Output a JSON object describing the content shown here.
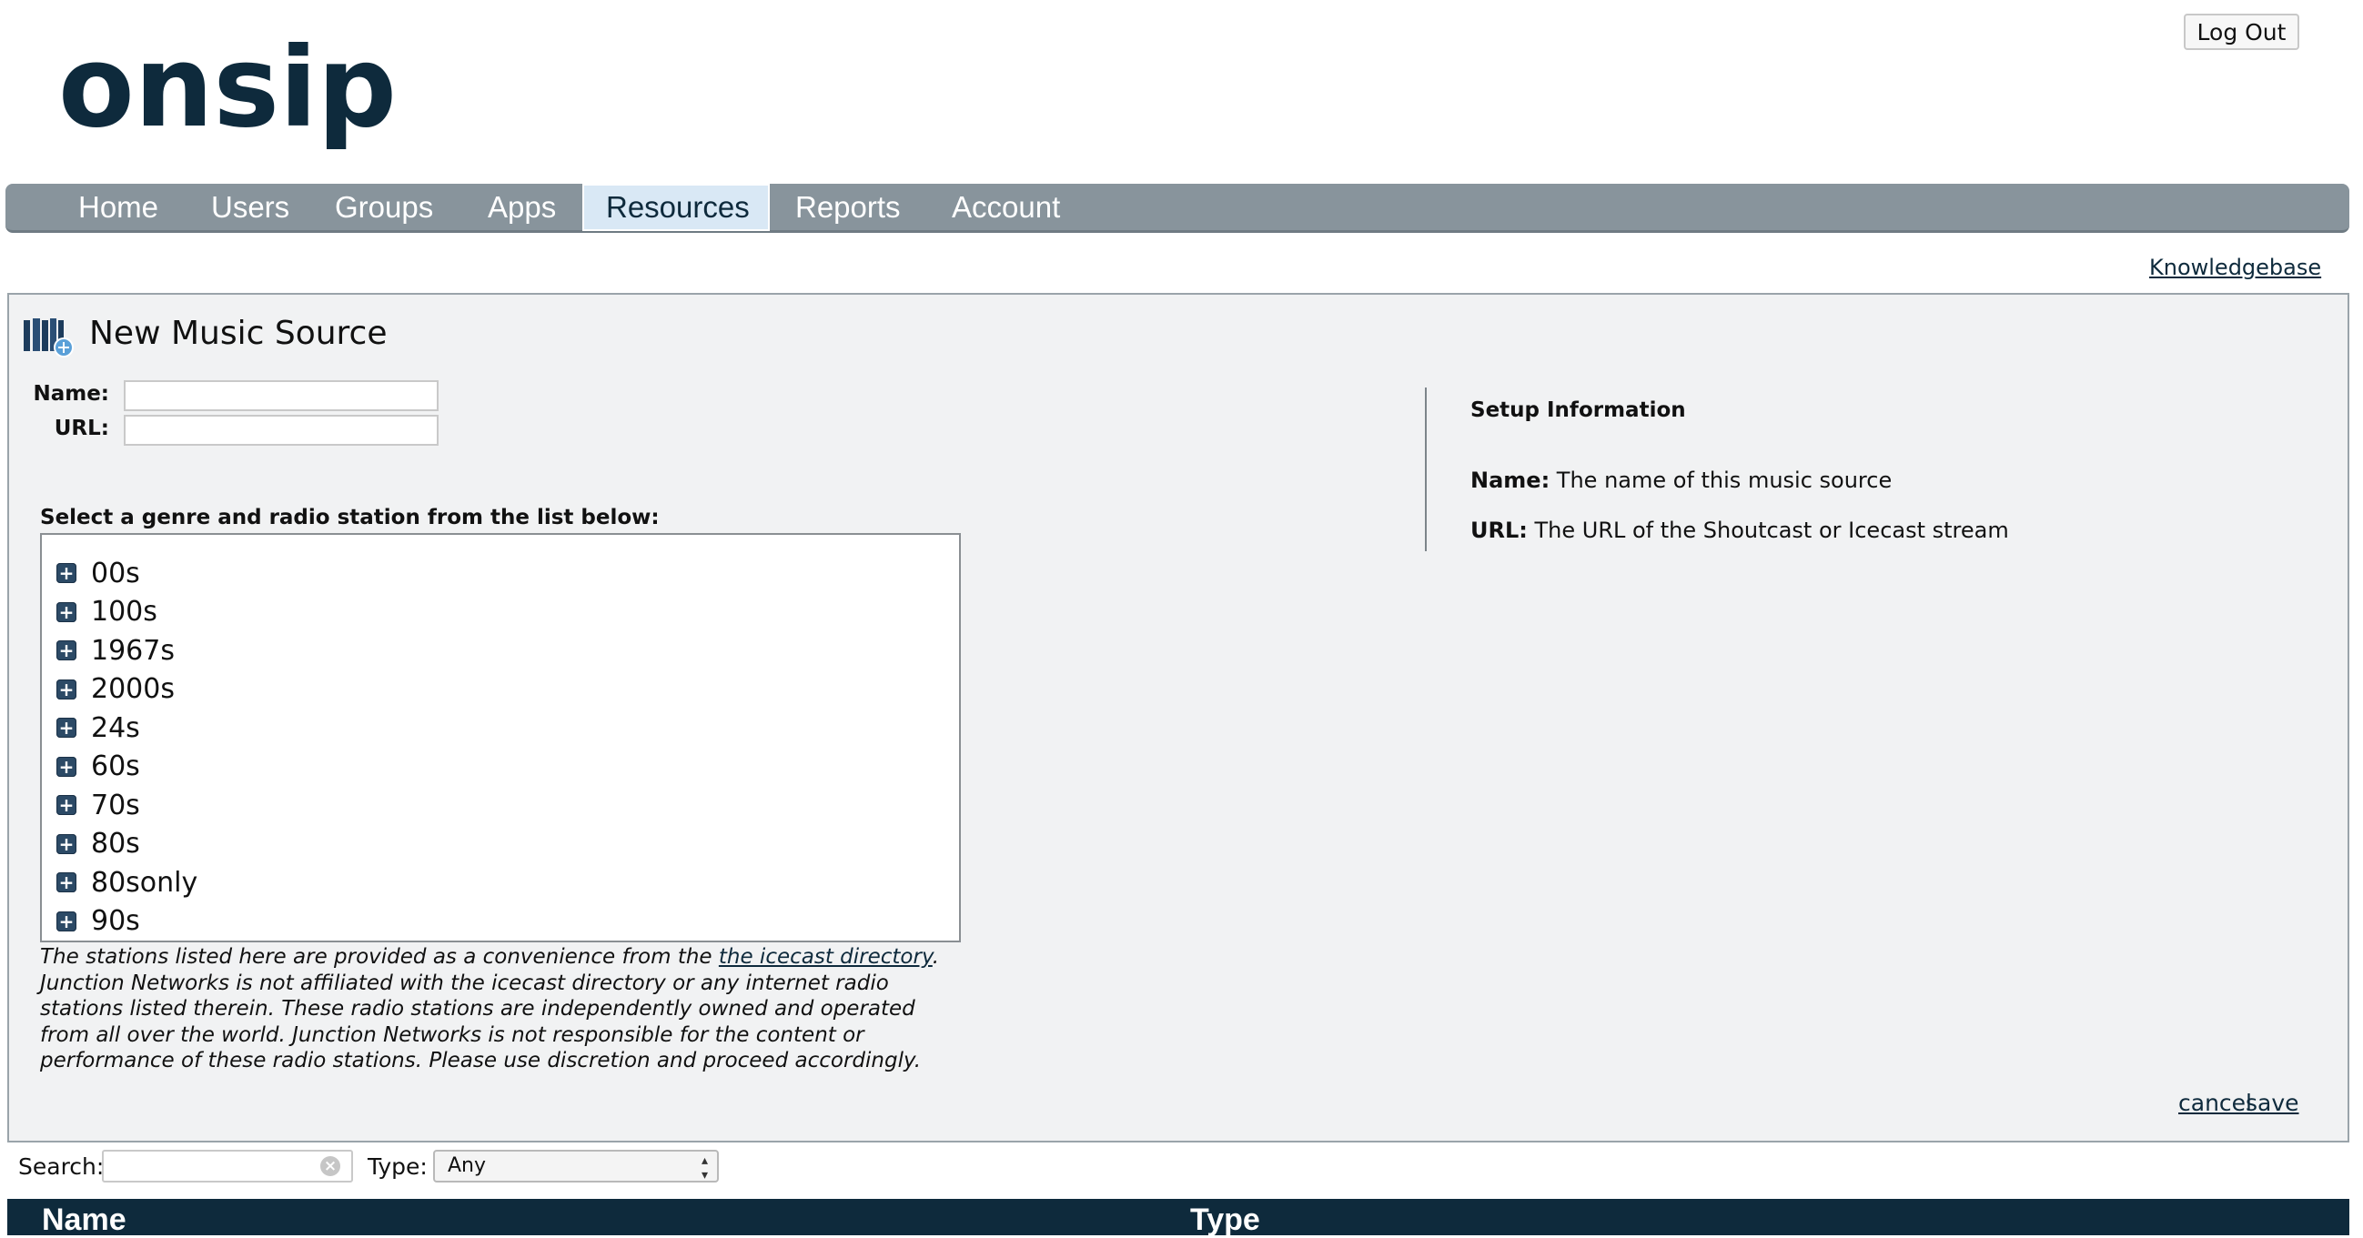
{
  "header": {
    "logo_text": "onsip",
    "logout_label": "Log Out"
  },
  "nav": {
    "items": [
      {
        "label": "Home"
      },
      {
        "label": "Users"
      },
      {
        "label": "Groups"
      },
      {
        "label": "Apps"
      },
      {
        "label": "Resources",
        "active": true
      },
      {
        "label": "Reports"
      },
      {
        "label": "Account"
      }
    ]
  },
  "knowledgebase_label": "Knowledgebase",
  "form": {
    "title": "New Music Source",
    "name_label": "Name:",
    "name_value": "",
    "url_label": "URL:",
    "url_value": "",
    "select_prompt": "Select a genre and radio station from the list below:",
    "genres": [
      "00s",
      "100s",
      "1967s",
      "2000s",
      "24s",
      "60s",
      "70s",
      "80s",
      "80sonly",
      "90s"
    ],
    "disclaimer": {
      "before_link": "The stations listed here are provided as a convenience from the ",
      "link_text": "the icecast directory",
      "after_link": ". Junction Networks is not affiliated with the icecast directory or any internet radio stations listed therein. These radio stations are independently owned and operated from all over the world. Junction Networks is not responsible for the content or performance of these radio stations. Please use discretion and proceed accordingly."
    },
    "cancel_label": "cancel",
    "save_label": "save"
  },
  "setup": {
    "title": "Setup Information",
    "name_term": "Name:",
    "name_desc": " The name of this music source",
    "url_term": "URL:",
    "url_desc": " The URL of the Shoutcast or Icecast stream"
  },
  "filter": {
    "search_label": "Search:",
    "search_value": "",
    "type_label": "Type:",
    "type_value": "Any"
  },
  "table": {
    "columns": [
      "Name",
      "Type"
    ]
  },
  "colors": {
    "brand_navy": "#0e2a3c",
    "nav_gray": "#88949c",
    "panel_bg": "#f1f2f3"
  }
}
